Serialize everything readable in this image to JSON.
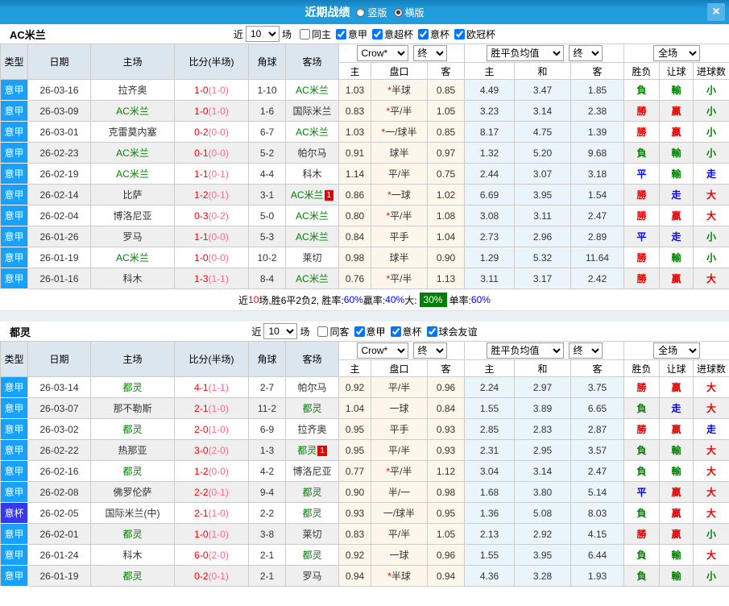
{
  "titlebar": {
    "title": "近期战绩",
    "layout_options": [
      {
        "label": "竖版",
        "selected": false
      },
      {
        "label": "横版",
        "selected": true
      }
    ],
    "close_glyph": "×"
  },
  "table_header": {
    "cols": [
      "类型",
      "日期",
      "主场",
      "比分(半场)",
      "角球",
      "客场"
    ],
    "sub_cols": [
      "主",
      "盘口",
      "客",
      "主",
      "和",
      "客",
      "胜负",
      "让球",
      "进球数"
    ],
    "odds_select": "Crow*",
    "odds_final_select": "终",
    "avg_select": "胜平负均值",
    "avg_final_select": "终",
    "scope_select": "全场"
  },
  "panels": [
    {
      "team": "AC米兰",
      "filter": {
        "prefix": "近",
        "count": "10",
        "suffix": "场",
        "toggle": {
          "label": "同主",
          "checked": false
        },
        "comps": [
          {
            "label": "意甲",
            "checked": true
          },
          {
            "label": "意超杯",
            "checked": true
          },
          {
            "label": "意杯",
            "checked": true
          },
          {
            "label": "欧冠杯",
            "checked": true
          }
        ]
      },
      "rows": [
        {
          "type": "意甲",
          "date": "26-03-16",
          "home": "拉齐奥",
          "score": "1-0",
          "half": "(1-0)",
          "corner": "1-10",
          "away": "AC米兰",
          "odds": [
            "1.03",
            "*半球",
            "0.85"
          ],
          "avg": [
            "4.49",
            "3.47",
            "1.85"
          ],
          "res": [
            "負",
            "輸",
            "小"
          ]
        },
        {
          "type": "意甲",
          "date": "26-03-09",
          "home": "AC米兰",
          "score": "1-0",
          "half": "(1-0)",
          "corner": "1-6",
          "away": "国际米兰",
          "odds": [
            "0.83",
            "*平/半",
            "1.05"
          ],
          "avg": [
            "3.23",
            "3.14",
            "2.38"
          ],
          "res": [
            "勝",
            "贏",
            "小"
          ]
        },
        {
          "type": "意甲",
          "date": "26-03-01",
          "home": "克雷莫内塞",
          "score": "0-2",
          "half": "(0-0)",
          "corner": "6-7",
          "away": "AC米兰",
          "odds": [
            "1.03",
            "*一/球半",
            "0.85"
          ],
          "avg": [
            "8.17",
            "4.75",
            "1.39"
          ],
          "res": [
            "勝",
            "贏",
            "小"
          ]
        },
        {
          "type": "意甲",
          "date": "26-02-23",
          "home": "AC米兰",
          "score": "0-1",
          "half": "(0-0)",
          "corner": "5-2",
          "away": "帕尔马",
          "odds": [
            "0.91",
            "球半",
            "0.97"
          ],
          "avg": [
            "1.32",
            "5.20",
            "9.68"
          ],
          "res": [
            "負",
            "輸",
            "小"
          ]
        },
        {
          "type": "意甲",
          "date": "26-02-19",
          "home": "AC米兰",
          "score": "1-1",
          "half": "(0-1)",
          "corner": "4-4",
          "away": "科木",
          "odds": [
            "1.14",
            "平/半",
            "0.75"
          ],
          "avg": [
            "2.44",
            "3.07",
            "3.18"
          ],
          "res": [
            "平",
            "輸",
            "走"
          ]
        },
        {
          "type": "意甲",
          "date": "26-02-14",
          "home": "比萨",
          "score": "1-2",
          "half": "(0-1)",
          "corner": "3-1",
          "away": "AC米兰",
          "away_badge": "1",
          "odds": [
            "0.86",
            "*一球",
            "1.02"
          ],
          "avg": [
            "6.69",
            "3.95",
            "1.54"
          ],
          "res": [
            "勝",
            "走",
            "大"
          ]
        },
        {
          "type": "意甲",
          "date": "26-02-04",
          "home": "博洛尼亚",
          "score": "0-3",
          "half": "(0-2)",
          "corner": "5-0",
          "away": "AC米兰",
          "odds": [
            "0.80",
            "*平/半",
            "1.08"
          ],
          "avg": [
            "3.08",
            "3.11",
            "2.47"
          ],
          "res": [
            "勝",
            "贏",
            "大"
          ]
        },
        {
          "type": "意甲",
          "date": "26-01-26",
          "home": "罗马",
          "score": "1-1",
          "half": "(0-0)",
          "corner": "5-3",
          "away": "AC米兰",
          "odds": [
            "0.84",
            "平手",
            "1.04"
          ],
          "avg": [
            "2.73",
            "2.96",
            "2.89"
          ],
          "res": [
            "平",
            "走",
            "小"
          ]
        },
        {
          "type": "意甲",
          "date": "26-01-19",
          "home": "AC米兰",
          "score": "1-0",
          "half": "(0-0)",
          "corner": "10-2",
          "away": "莱切",
          "odds": [
            "0.98",
            "球半",
            "0.90"
          ],
          "avg": [
            "1.29",
            "5.32",
            "11.64"
          ],
          "res": [
            "勝",
            "輸",
            "小"
          ]
        },
        {
          "type": "意甲",
          "date": "26-01-16",
          "home": "科木",
          "score": "1-3",
          "half": "(1-1)",
          "corner": "8-4",
          "away": "AC米兰",
          "odds": [
            "0.76",
            "*平/半",
            "1.13"
          ],
          "avg": [
            "3.11",
            "3.17",
            "2.42"
          ],
          "res": [
            "勝",
            "贏",
            "大"
          ]
        }
      ],
      "summary": [
        {
          "text": "近",
          "style": "plain"
        },
        {
          "text": "10",
          "style": "red"
        },
        {
          "text": "场,胜6平2负2, 胜率:",
          "style": "plain"
        },
        {
          "text": "60%",
          "style": "blue"
        },
        {
          "text": " 贏率:",
          "style": "plain"
        },
        {
          "text": "40%",
          "style": "blue"
        },
        {
          "text": " 大:",
          "style": "plain"
        },
        {
          "text": "30%",
          "style": "greenbox"
        },
        {
          "text": " 单率:",
          "style": "plain"
        },
        {
          "text": "60%",
          "style": "blue"
        }
      ]
    },
    {
      "team": "都灵",
      "filter": {
        "prefix": "近",
        "count": "10",
        "suffix": "场",
        "toggle": {
          "label": "同客",
          "checked": false
        },
        "comps": [
          {
            "label": "意甲",
            "checked": true
          },
          {
            "label": "意杯",
            "checked": true
          },
          {
            "label": "球会友谊",
            "checked": true
          }
        ]
      },
      "rows": [
        {
          "type": "意甲",
          "date": "26-03-14",
          "home": "都灵",
          "score": "4-1",
          "half": "(1-1)",
          "corner": "2-7",
          "away": "帕尔马",
          "odds": [
            "0.92",
            "平/半",
            "0.96"
          ],
          "avg": [
            "2.24",
            "2.97",
            "3.75"
          ],
          "res": [
            "勝",
            "贏",
            "大"
          ]
        },
        {
          "type": "意甲",
          "date": "26-03-07",
          "home": "那不勒斯",
          "score": "2-1",
          "half": "(1-0)",
          "corner": "11-2",
          "away": "都灵",
          "odds": [
            "1.04",
            "一球",
            "0.84"
          ],
          "avg": [
            "1.55",
            "3.89",
            "6.65"
          ],
          "res": [
            "負",
            "走",
            "大"
          ]
        },
        {
          "type": "意甲",
          "date": "26-03-02",
          "home": "都灵",
          "score": "2-0",
          "half": "(1-0)",
          "corner": "6-9",
          "away": "拉齐奥",
          "odds": [
            "0.95",
            "平手",
            "0.93"
          ],
          "avg": [
            "2.85",
            "2.83",
            "2.87"
          ],
          "res": [
            "勝",
            "贏",
            "走"
          ]
        },
        {
          "type": "意甲",
          "date": "26-02-22",
          "home": "热那亚",
          "score": "3-0",
          "half": "(2-0)",
          "corner": "1-3",
          "away": "都灵",
          "away_badge": "1",
          "odds": [
            "0.95",
            "平/半",
            "0.93"
          ],
          "avg": [
            "2.31",
            "2.95",
            "3.57"
          ],
          "res": [
            "負",
            "輸",
            "大"
          ]
        },
        {
          "type": "意甲",
          "date": "26-02-16",
          "home": "都灵",
          "score": "1-2",
          "half": "(0-0)",
          "corner": "4-2",
          "away": "博洛尼亚",
          "odds": [
            "0.77",
            "*平/半",
            "1.12"
          ],
          "avg": [
            "3.04",
            "3.14",
            "2.47"
          ],
          "res": [
            "負",
            "輸",
            "大"
          ]
        },
        {
          "type": "意甲",
          "date": "26-02-08",
          "home": "佛罗伦萨",
          "score": "2-2",
          "half": "(0-1)",
          "corner": "9-4",
          "away": "都灵",
          "odds": [
            "0.90",
            "半/一",
            "0.98"
          ],
          "avg": [
            "1.68",
            "3.80",
            "5.14"
          ],
          "res": [
            "平",
            "贏",
            "大"
          ]
        },
        {
          "type": "意杯",
          "date": "26-02-05",
          "home": "国际米兰(中)",
          "score": "2-1",
          "half": "(1-0)",
          "corner": "2-2",
          "away": "都灵",
          "odds": [
            "0.93",
            "一/球半",
            "0.95"
          ],
          "avg": [
            "1.36",
            "5.08",
            "8.03"
          ],
          "res": [
            "負",
            "贏",
            "大"
          ]
        },
        {
          "type": "意甲",
          "date": "26-02-01",
          "home": "都灵",
          "score": "1-0",
          "half": "(1-0)",
          "corner": "3-8",
          "away": "莱切",
          "odds": [
            "0.83",
            "平/半",
            "1.05"
          ],
          "avg": [
            "2.13",
            "2.92",
            "4.15"
          ],
          "res": [
            "勝",
            "贏",
            "小"
          ]
        },
        {
          "type": "意甲",
          "date": "26-01-24",
          "home": "科木",
          "score": "6-0",
          "half": "(2-0)",
          "corner": "2-1",
          "away": "都灵",
          "odds": [
            "0.92",
            "一球",
            "0.96"
          ],
          "avg": [
            "1.55",
            "3.95",
            "6.44"
          ],
          "res": [
            "負",
            "輸",
            "大"
          ]
        },
        {
          "type": "意甲",
          "date": "26-01-19",
          "home": "都灵",
          "score": "0-2",
          "half": "(0-1)",
          "corner": "2-1",
          "away": "罗马",
          "odds": [
            "0.94",
            "*半球",
            "0.94"
          ],
          "avg": [
            "4.36",
            "3.28",
            "1.93"
          ],
          "res": [
            "負",
            "輸",
            "小"
          ]
        }
      ],
      "summary": []
    }
  ],
  "colors": {
    "titlebar_blue": "#209bdb",
    "league_serie_a_blue": "#19a0fa",
    "cup_blue_violet": "#3838f0",
    "win_red": "#e60000",
    "lose_green": "#008000",
    "draw_blue": "#0000ff",
    "score_red": "#ff0000",
    "half_score_pink": "#ff6a8a",
    "header_bg": "#dce6ef",
    "row_alt_bg": "#efefef",
    "odds_bg": "#fdf6ea",
    "avg_bg": "#eaf4fb"
  }
}
